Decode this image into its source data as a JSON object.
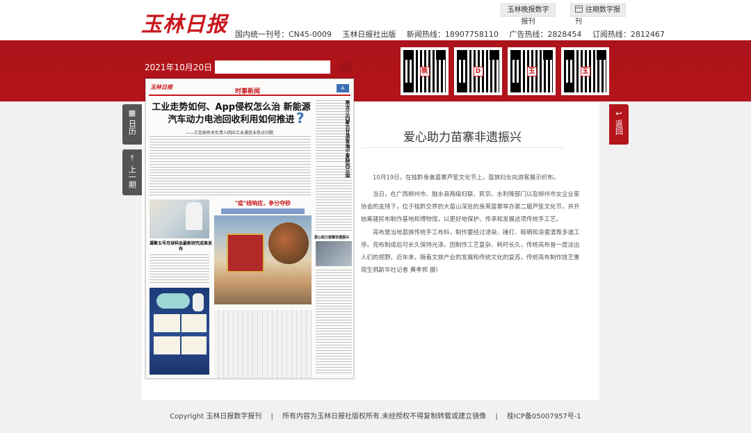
{
  "header": {
    "logo_text": "玉林日报",
    "btn_mobile": "玉林晚报数字报刊",
    "btn_past": "往期数字报刊",
    "info": {
      "cn": "国内统一刊号：CN45-0009",
      "publisher": "玉林日报社出版",
      "news_hotline": "新闻热线：18907758110",
      "ad_hotline": "广告热线：2828454",
      "sub_hotline": "订阅热线：2812467"
    }
  },
  "band": {
    "date": "2021年10月20日",
    "date_input_value": "",
    "qr_marks": [
      "晚",
      "D",
      "玉",
      "玉"
    ]
  },
  "side": {
    "calendar": "日历",
    "prev": "上一期",
    "back": "返回"
  },
  "paper": {
    "logo": "玉林日报",
    "section": "时事新闻",
    "page_badge": "A",
    "headline": "工业走势如何、App侵权怎么治 新能源汽车动力电池回收利用如何推进",
    "question_mark": "?",
    "subhead": "——工信部有关负责人回应工业通信业热点问题",
    "vertical_title": "黑龙江内蒙古甘肃青海宁夏陕西云南",
    "h2": "凝聚五号月球样品最新研究成果发布",
    "banner_title": "\"疫\"线响应，争分夺秒",
    "h3": "爱心助力苗寨非遗振兴"
  },
  "article": {
    "title": "爱心助力苗寨非遗振兴",
    "paragraphs": [
      "10月19日，在桂黔身美苗寨芦笙文化节上，苗族妇女向游客展示织布。",
      "当日，在广西柳州市、融水县两级妇联、民宗、水利等部门以及柳州市女企业家协会的支持下，位于桂黔交界的大苗山深处的身英苗寨举办第二届芦笙文化节，并开始筹建民布制作基地和博物馆，以更好地保护、传承和发展这项传统手工艺。",
      "亮布是当地苗族传统手工布料，制作要经过浸染、捶打、晾晒和涂蛋清等多道工序。完布制成后可长久保持光泽。因制作工艺复杂、耗时长久，传统亮布曾一度淡出人们的视野。近年来，随着文旅产业的发展和传统文化的复苏，传统亮布制作技艺重现生机。",
      "（新华社记者 黄孝邦 摄）"
    ]
  },
  "footer": {
    "copyright": "Copyright 玉林日报数字报刊",
    "sep1": "|",
    "rights": "所有内容为玉林日报社版权所有.未经授权不得复制转载或建立镜像",
    "sep2": "|",
    "icp": "桂ICP备05007957号-1"
  },
  "colors": {
    "brand_red": "#b4141b",
    "logo_red": "#c8161d",
    "side_tab_gray": "#555555"
  }
}
